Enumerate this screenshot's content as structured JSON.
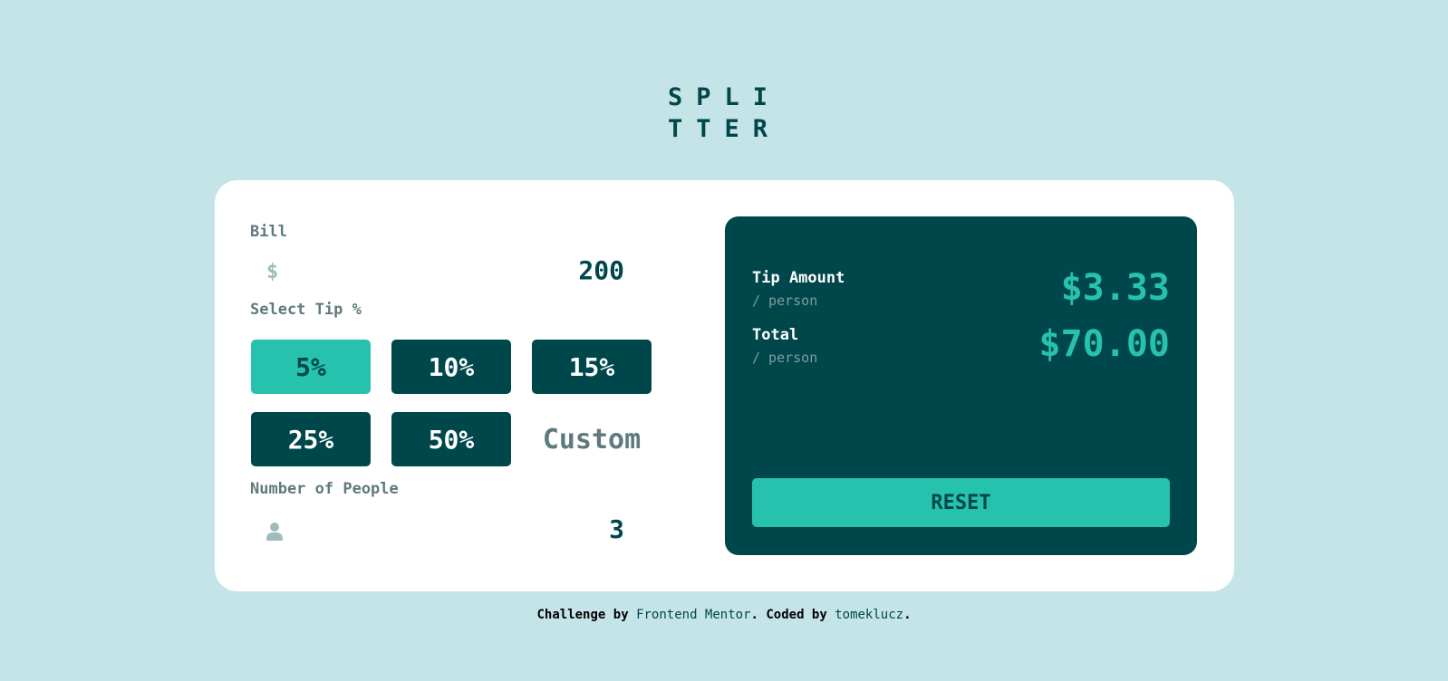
{
  "logo": {
    "line1": "SPLI",
    "line2": "TTER"
  },
  "bill": {
    "label": "Bill",
    "icon": "dollar-icon",
    "currency_symbol": "$",
    "value": "200"
  },
  "tip": {
    "label": "Select Tip %",
    "options": [
      "5%",
      "10%",
      "15%",
      "25%",
      "50%"
    ],
    "selected": "5%",
    "custom_placeholder": "Custom"
  },
  "people": {
    "label": "Number of People",
    "icon": "person-icon",
    "value": "3"
  },
  "results": {
    "tip_amount_label": "Tip Amount",
    "tip_amount_sub": "/ person",
    "tip_amount_value": "$3.33",
    "total_label": "Total",
    "total_sub": "/ person",
    "total_value": "$70.00",
    "reset_label": "RESET"
  },
  "footer": {
    "prefix": "Challenge by ",
    "link1": "Frontend Mentor",
    "middle": ". Coded by ",
    "link2": "tomeklucz",
    "suffix": "."
  },
  "colors": {
    "background": "#c5e4e7",
    "dark_teal": "#00474b",
    "accent": "#26c2ae",
    "muted": "#5e7a7d"
  }
}
